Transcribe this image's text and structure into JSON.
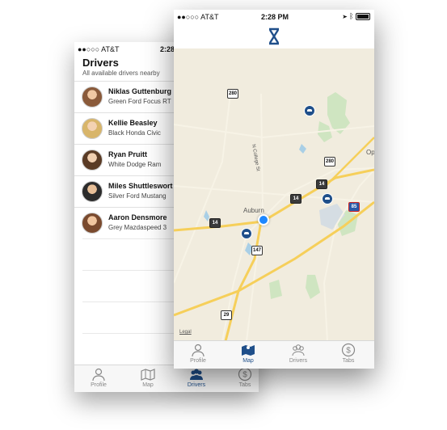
{
  "back_phone": {
    "status": {
      "carrier": "●●○○○ AT&T",
      "time": "2:28"
    },
    "title": "Drivers",
    "subtitle": "All available drivers nearby",
    "drivers": [
      {
        "name": "Niklas Guttenburg",
        "car": "Green Ford Focus RT"
      },
      {
        "name": "Kellie Beasley",
        "car": "Black Honda Civic"
      },
      {
        "name": "Ryan Pruitt",
        "car": "White Dodge Ram"
      },
      {
        "name": "Miles Shuttleswort",
        "car": "Silver Ford Mustang"
      },
      {
        "name": "Aaron Densmore",
        "car": "Grey Mazdaspeed 3"
      }
    ],
    "tabs": [
      {
        "label": "Profile",
        "icon": "person-icon"
      },
      {
        "label": "Map",
        "icon": "map-icon"
      },
      {
        "label": "Drivers",
        "icon": "group-icon"
      },
      {
        "label": "Tabs",
        "icon": "dollar-icon"
      }
    ],
    "active_tab": "Drivers"
  },
  "front_phone": {
    "status": {
      "carrier": "●●○○○ AT&T",
      "time": "2:28 PM"
    },
    "map": {
      "town_label": "Auburn",
      "street_label": "N College St",
      "edge_label": "Op",
      "legal": "Legal",
      "route_shields": [
        "280",
        "280",
        "14",
        "14",
        "14",
        "147",
        "29",
        "85"
      ]
    },
    "tabs": [
      {
        "label": "Profile",
        "icon": "person-icon"
      },
      {
        "label": "Map",
        "icon": "map-icon"
      },
      {
        "label": "Drivers",
        "icon": "group-icon"
      },
      {
        "label": "Tabs",
        "icon": "dollar-icon"
      }
    ],
    "active_tab": "Map"
  },
  "colors": {
    "accent": "#1f4f8a",
    "location_dot": "#1e88ff",
    "map_bg": "#f1ecde",
    "highway": "#f6cf5a"
  }
}
